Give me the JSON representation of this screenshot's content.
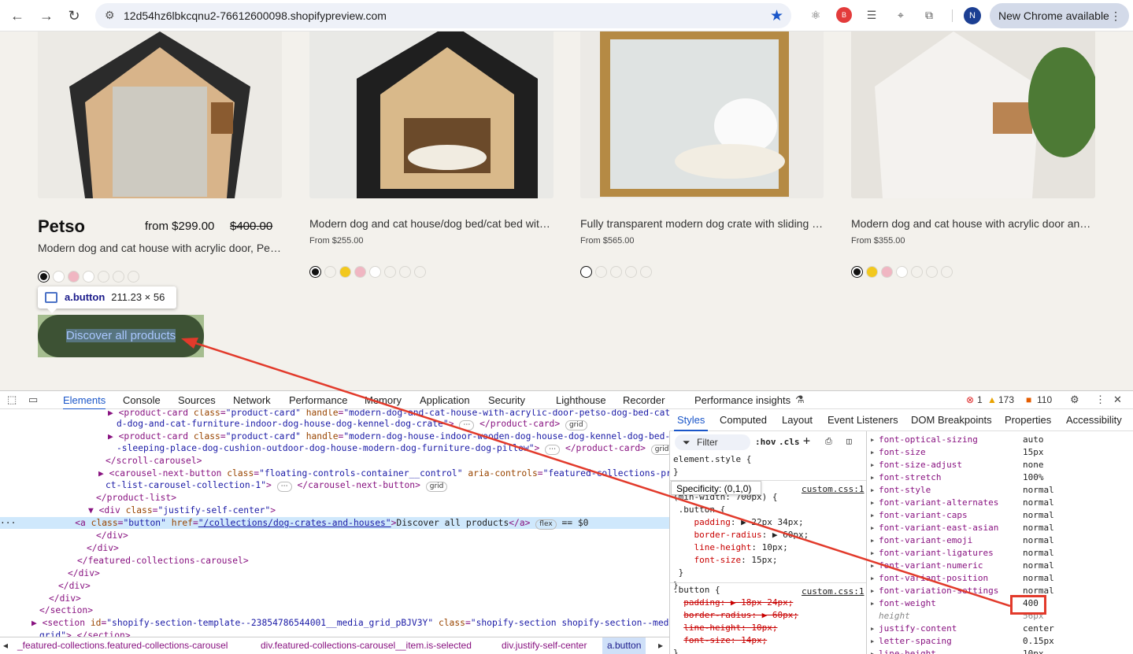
{
  "browser": {
    "url": "12d54hz6lbkcqnu2-76612600098.shopifypreview.com",
    "avatar_letter": "N",
    "update_label": "New Chrome available"
  },
  "products": [
    {
      "title": "Petso",
      "price": "from $299.00",
      "compare_price": "$400.00",
      "description": "Modern dog and cat house with acrylic door, Petso dog bed cat bed"
    },
    {
      "title": "Modern dog and cat house/dog bed/cat bed with acrylic door",
      "price": "From $255.00"
    },
    {
      "title": "Fully transparent modern dog crate with sliding door",
      "price": "From $565.00"
    },
    {
      "title": "Modern dog and cat house with acrylic door and window",
      "price": "From $355.00"
    }
  ],
  "swatch_colors": {
    "black": "#111111",
    "yellow": "#f2c81e",
    "pink": "#f0b6c2",
    "white": "#ffffff",
    "lightgray": "#f3f1ec"
  },
  "tooltip": {
    "selector": "a.button",
    "dimensions": "211.23 × 56"
  },
  "cta": {
    "label": "Discover all products"
  },
  "devtools": {
    "tabs": [
      "Elements",
      "Console",
      "Sources",
      "Network",
      "Performance",
      "Memory",
      "Application",
      "Security",
      "Lighthouse",
      "Recorder",
      "Performance insights"
    ],
    "errors": "1",
    "warnings": "173",
    "issues": "110",
    "styles_tabs": [
      "Styles",
      "Computed",
      "Layout",
      "Event Listeners",
      "DOM Breakpoints",
      "Properties",
      "Accessibility"
    ],
    "filter_placeholder": "Filter",
    "hov": ":hov",
    "cls": ".cls",
    "specificity": "Specificity: (0,1,0)",
    "css_source": "custom.css:1",
    "computed": [
      {
        "name": "font-optical-sizing",
        "value": "auto"
      },
      {
        "name": "font-size",
        "value": "15px"
      },
      {
        "name": "font-size-adjust",
        "value": "none"
      },
      {
        "name": "font-stretch",
        "value": "100%"
      },
      {
        "name": "font-style",
        "value": "normal"
      },
      {
        "name": "font-variant-alternates",
        "value": "normal"
      },
      {
        "name": "font-variant-caps",
        "value": "normal"
      },
      {
        "name": "font-variant-east-asian",
        "value": "normal"
      },
      {
        "name": "font-variant-emoji",
        "value": "normal"
      },
      {
        "name": "font-variant-ligatures",
        "value": "normal"
      },
      {
        "name": "font-variant-numeric",
        "value": "normal"
      },
      {
        "name": "font-variant-position",
        "value": "normal"
      },
      {
        "name": "font-variation-settings",
        "value": "normal"
      },
      {
        "name": "font-weight",
        "value": "400"
      },
      {
        "name": "height",
        "value": "56px",
        "sub": true
      },
      {
        "name": "justify-content",
        "value": "center"
      },
      {
        "name": "letter-spacing",
        "value": "0.15px"
      },
      {
        "name": "line-height",
        "value": "10px"
      }
    ],
    "breadcrumbs": [
      "_featured-collections.featured-collections-carousel",
      "div.featured-collections-carousel__item.is-selected",
      "div.justify-self-center",
      "a.button"
    ]
  }
}
